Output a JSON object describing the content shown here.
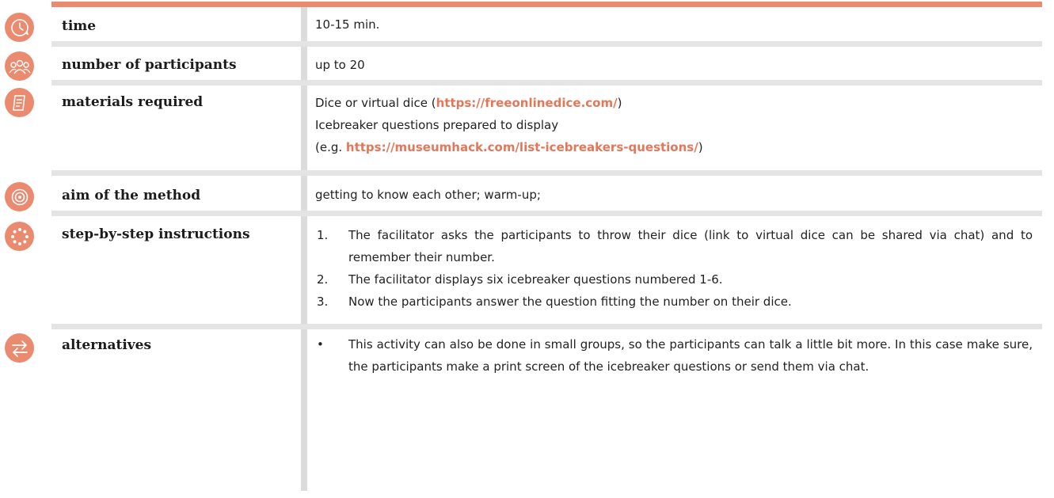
{
  "rows": [
    {
      "icon": "clock-icon",
      "label": "time",
      "value": "10-15 min."
    },
    {
      "icon": "participants-icon",
      "label": "number of participants",
      "value": "up to 20"
    },
    {
      "icon": "document-icon",
      "label": "materials required",
      "lines": [
        {
          "pre": "Dice or virtual dice (",
          "link": "https://freeonlinedice.com/",
          "post": ")"
        },
        {
          "text": "Icebreaker questions prepared to display"
        },
        {
          "pre": "(e.g. ",
          "link": "https://museumhack.com/list-icebreakers-questions/",
          "post": ")"
        }
      ]
    },
    {
      "icon": "target-icon",
      "label": "aim of the method",
      "value": "getting to know each other; warm-up;"
    },
    {
      "icon": "steps-icon",
      "label": "step-by-step instructions",
      "steps": [
        {
          "num": "1.",
          "text": "The facilitator asks the participants to throw their dice (link to virtual dice can be shared via chat) and to remember their number."
        },
        {
          "num": "2.",
          "text": "The facilitator displays six icebreaker questions numbered 1-6."
        },
        {
          "num": "3.",
          "text": "Now the participants answer the question fitting the number on their dice."
        }
      ]
    },
    {
      "icon": "arrows-icon",
      "label": "alternatives",
      "bullets": [
        {
          "mark": "•",
          "text": "This activity can also be done in small groups, so the participants can talk a little bit more. In this case make sure, the participants make a print screen of the icebreaker questions or send them via chat."
        }
      ]
    }
  ],
  "colors": {
    "accent": "#ea8a6f",
    "link": "#e3775a",
    "divider": "#e4e4e4"
  }
}
